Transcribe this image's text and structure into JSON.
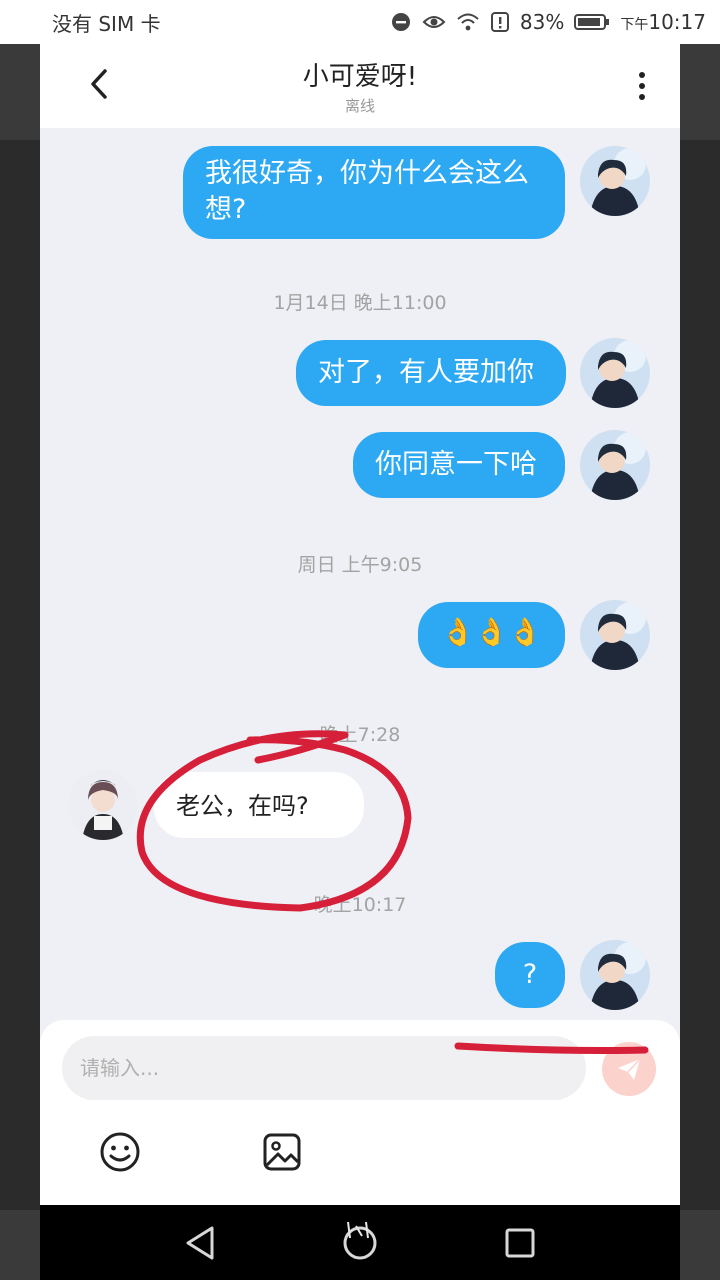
{
  "status_bar": {
    "carrier": "没有 SIM 卡",
    "battery": "83%",
    "ampm": "下午",
    "time": "10:17"
  },
  "header": {
    "title": "小可爱呀!",
    "subtitle": "离线"
  },
  "messages": [
    {
      "text": "我很好奇，你为什么会这么想?",
      "line1": "我很好奇，你为什么会这么",
      "line2": "想?"
    },
    {
      "text": "对了，有人要加你"
    },
    {
      "text": "你同意一下哈"
    },
    {
      "text": "👌👌👌"
    },
    {
      "text": "老公，在吗?"
    },
    {
      "text": "?"
    }
  ],
  "timestamps": [
    "1月14日 晚上11:00",
    "周日 上午9:05",
    "晚上7:28",
    "晚上10:17"
  ],
  "composer": {
    "placeholder": "请输入..."
  },
  "colors": {
    "bubble_out": "#2da8f3",
    "annotation": "#d6203a",
    "send_disabled": "#fbd3cc"
  },
  "icons": [
    "back-icon",
    "more-icon",
    "emoji-icon",
    "image-icon",
    "send-icon",
    "nav-back-icon",
    "nav-home-icon",
    "nav-recents-icon"
  ]
}
